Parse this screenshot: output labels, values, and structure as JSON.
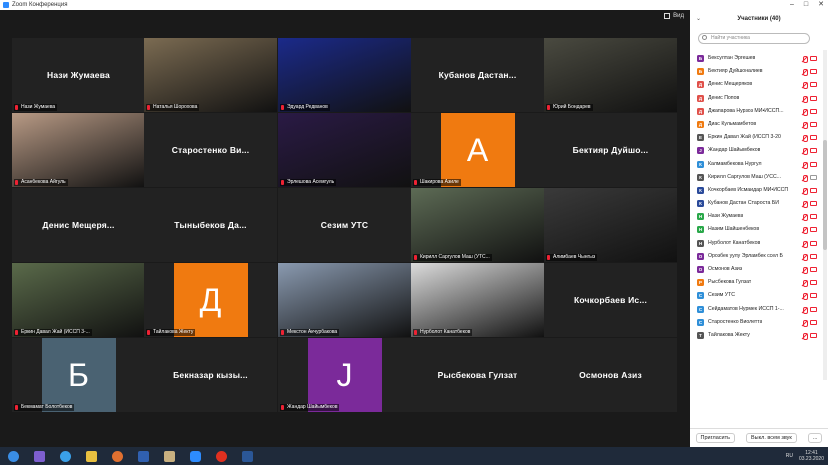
{
  "window": {
    "title": "Zoom Конференция",
    "view_label": "Вид"
  },
  "tiles": [
    {
      "big": "Нази Жумаева",
      "label": "Нази Жумаева",
      "type": "name"
    },
    {
      "big": "",
      "label": "Наталья Шорохова",
      "type": "photo",
      "bg": "#7b6b52",
      "active": true
    },
    {
      "big": "",
      "label": "Эдуард Редванов",
      "type": "photo",
      "bg": "#1b2a8a"
    },
    {
      "big": "Кубанов Дастан...",
      "label": "",
      "type": "name"
    },
    {
      "big": "",
      "label": "Юрий Бондарев",
      "type": "photo",
      "bg": "#4a4a40"
    },
    {
      "big": "",
      "label": "Асанбекова Айгуль",
      "type": "photo",
      "bg": "#b89a85"
    },
    {
      "big": "Старостенко Ви...",
      "label": "",
      "type": "name"
    },
    {
      "big": "",
      "label": "Эрлешова Асемгуль",
      "type": "photo",
      "bg": "#2a1a45"
    },
    {
      "big": "",
      "label": "Шакирова Азиле",
      "type": "avatar",
      "letter": "А",
      "bg": "#f07a10"
    },
    {
      "big": "Бектияр Дуйшо...",
      "label": "",
      "type": "name"
    },
    {
      "big": "Денис Мещеря...",
      "label": "",
      "type": "name"
    },
    {
      "big": "Тыныбеков Да...",
      "label": "",
      "type": "name"
    },
    {
      "big": "Сезим УТС",
      "label": "",
      "type": "name"
    },
    {
      "big": "",
      "label": "Кирилл Саргулов Маш (УТС...",
      "type": "photo",
      "bg": "#5d6b55"
    },
    {
      "big": "",
      "label": "Алимбаев Чынгыз",
      "type": "photo",
      "bg": "#3a3a3a"
    },
    {
      "big": "",
      "label": "Еркин Давал Жай (ИССП 3-...",
      "type": "photo",
      "bg": "#5a6a4a"
    },
    {
      "big": "",
      "label": "Тайлакова Жекту",
      "type": "avatar",
      "letter": "Д",
      "bg": "#f07a10"
    },
    {
      "big": "",
      "label": "Мекстон Акчурбакова",
      "type": "photo",
      "bg": "#8a9ab0"
    },
    {
      "big": "",
      "label": "Нурболот Канатбеков",
      "type": "photo",
      "bg": "#dcdcdc"
    },
    {
      "big": "Кочкорбаев Ис...",
      "label": "",
      "type": "name"
    },
    {
      "big": "",
      "label": "Бекмамат Болотбеков",
      "type": "avatar",
      "letter": "Б",
      "bg": "#4a6272"
    },
    {
      "big": "Бекназар кызы...",
      "label": "",
      "type": "name"
    },
    {
      "big": "",
      "label": "Жандар Шайымбеков",
      "type": "avatar",
      "letter": "J",
      "bg": "#7b2a9a"
    },
    {
      "big": "Рысбекова Гулзат",
      "label": "",
      "type": "name"
    },
    {
      "big": "Осмонов Азиз",
      "label": "",
      "type": "name"
    }
  ],
  "sidebar": {
    "title": "Участники (40)",
    "search_placeholder": "Найти участника",
    "participants": [
      {
        "initial": "Б",
        "name": "Бексултан Эргешев",
        "color": "#7b2a9a",
        "cam_on": false
      },
      {
        "initial": "Б",
        "name": "Бектияр Дуйшоналиев",
        "color": "#f07a10",
        "cam_on": false
      },
      {
        "initial": "Д",
        "name": "Денис Мещеряков",
        "color": "#e0504a",
        "cam_on": false
      },
      {
        "initial": "Д",
        "name": "Денис Попов",
        "color": "#e0504a",
        "cam_on": false
      },
      {
        "initial": "Д",
        "name": "Джапарова Нурзоз МИ•ИССП...",
        "color": "#e0504a",
        "cam_on": false
      },
      {
        "initial": "Д",
        "name": "Диас Кульмамбетов",
        "color": "#f07a10",
        "cam_on": false
      },
      {
        "initial": "Е",
        "name": "Еркин Давал Жай (ИССП 3-20",
        "color": "#555",
        "cam_on": false
      },
      {
        "initial": "J",
        "name": "Жандар Шайымбеков",
        "color": "#7b2a9a",
        "cam_on": false
      },
      {
        "initial": "К",
        "name": "Калмамбекова Нургул",
        "color": "#2f8fd8",
        "cam_on": false
      },
      {
        "initial": "К",
        "name": "Кирилл Саргулов Маш (УСС...",
        "color": "#555",
        "cam_on": true
      },
      {
        "initial": "К",
        "name": "Кочкорбаев Исмаидар МИ•ИССП 1-...",
        "color": "#2a4a9a",
        "cam_on": false
      },
      {
        "initial": "К",
        "name": "Кубанов Дастан Староста БИ",
        "color": "#2a4a9a",
        "cam_on": false
      },
      {
        "initial": "Н",
        "name": "Нази Жумаева",
        "color": "#2aa84a",
        "cam_on": false
      },
      {
        "initial": "Н",
        "name": "Назим Шайшенбеков",
        "color": "#2aa84a",
        "cam_on": false
      },
      {
        "initial": "Н",
        "name": "Нурболот Канатбеков",
        "color": "#555",
        "cam_on": false
      },
      {
        "initial": "О",
        "name": "Орозбек уулу Эрламбек ссел Б",
        "color": "#7b2a9a",
        "cam_on": false
      },
      {
        "initial": "О",
        "name": "Осмонов Азиз",
        "color": "#7b2a9a",
        "cam_on": false
      },
      {
        "initial": "Р",
        "name": "Рысбекова Гулзат",
        "color": "#f07a10",
        "cam_on": false
      },
      {
        "initial": "С",
        "name": "Сезим УТС",
        "color": "#2f8fd8",
        "cam_on": false
      },
      {
        "initial": "С",
        "name": "Сейдаматов Нурмек ИССП 1-...",
        "color": "#2f8fd8",
        "cam_on": false
      },
      {
        "initial": "С",
        "name": "Старостенко Виолетта",
        "color": "#2f8fd8",
        "cam_on": false
      },
      {
        "initial": "Т",
        "name": "Тайлакова Жекту",
        "color": "#555",
        "cam_on": false
      }
    ],
    "invite_label": "Пригласить",
    "mute_all_label": "Выкл. всем звук",
    "more_label": "..."
  },
  "taskbar": {
    "time": "12:41",
    "date": "03.23.2020"
  }
}
